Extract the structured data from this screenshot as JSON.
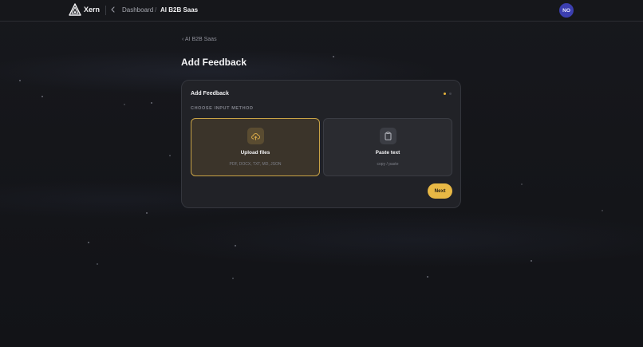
{
  "app": {
    "brand": "Xern"
  },
  "breadcrumb": {
    "dashboard": "Dashboard",
    "separator": "/",
    "current": "AI B2B Saas"
  },
  "user": {
    "initials": "NO",
    "avatar_color": "#3c3fb0"
  },
  "page": {
    "back_label": "AI B2B Saas",
    "title": "Add Feedback"
  },
  "card": {
    "title": "Add Feedback",
    "section_label": "CHOOSE INPUT METHOD",
    "steps": {
      "current": 1,
      "total": 2
    },
    "options": [
      {
        "title": "Upload files",
        "subtitle": "PDF, DOCX, TXT, MD, JSON",
        "icon": "cloud-upload-icon",
        "selected": true
      },
      {
        "title": "Paste text",
        "subtitle": "copy / paste",
        "icon": "clipboard-icon",
        "selected": false
      }
    ],
    "next_label": "Next"
  },
  "colors": {
    "accent": "#e8b845",
    "background": "#16171c"
  }
}
